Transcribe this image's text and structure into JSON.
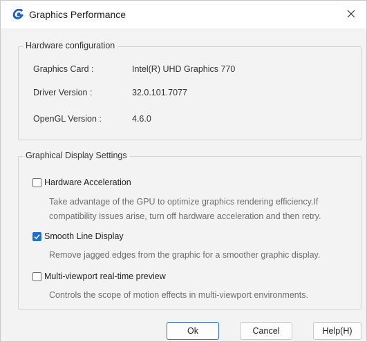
{
  "window": {
    "title": "Graphics Performance"
  },
  "hardware": {
    "legend": "Hardware configuration",
    "rows": [
      {
        "label": "Graphics Card :",
        "value": "Intel(R) UHD Graphics 770"
      },
      {
        "label": "Driver Version :",
        "value": "32.0.101.7077"
      },
      {
        "label": "OpenGL Version :",
        "value": "4.6.0"
      }
    ]
  },
  "display": {
    "legend": "Graphical Display Settings",
    "options": [
      {
        "label": "Hardware Acceleration",
        "checked": false,
        "desc": [
          "Take advantage of the GPU to optimize graphics rendering efficiency.If",
          "compatibility issues arise, turn off hardware acceleration and then retry."
        ]
      },
      {
        "label": "Smooth Line Display",
        "checked": true,
        "desc": [
          "Remove jagged edges from the graphic for a smoother graphic display."
        ]
      },
      {
        "label": "Multi-viewport real-time preview",
        "checked": false,
        "desc": [
          "Controls the scope of motion effects in multi-viewport environments."
        ]
      }
    ]
  },
  "buttons": {
    "ok": "Ok",
    "cancel": "Cancel",
    "help": "Help(H)"
  },
  "colors": {
    "accent": "#1f6fd1",
    "app_icon": "#1e63c9"
  },
  "icons": {
    "app": "app-logo-icon",
    "close": "close-icon",
    "check": "checkmark-icon"
  }
}
